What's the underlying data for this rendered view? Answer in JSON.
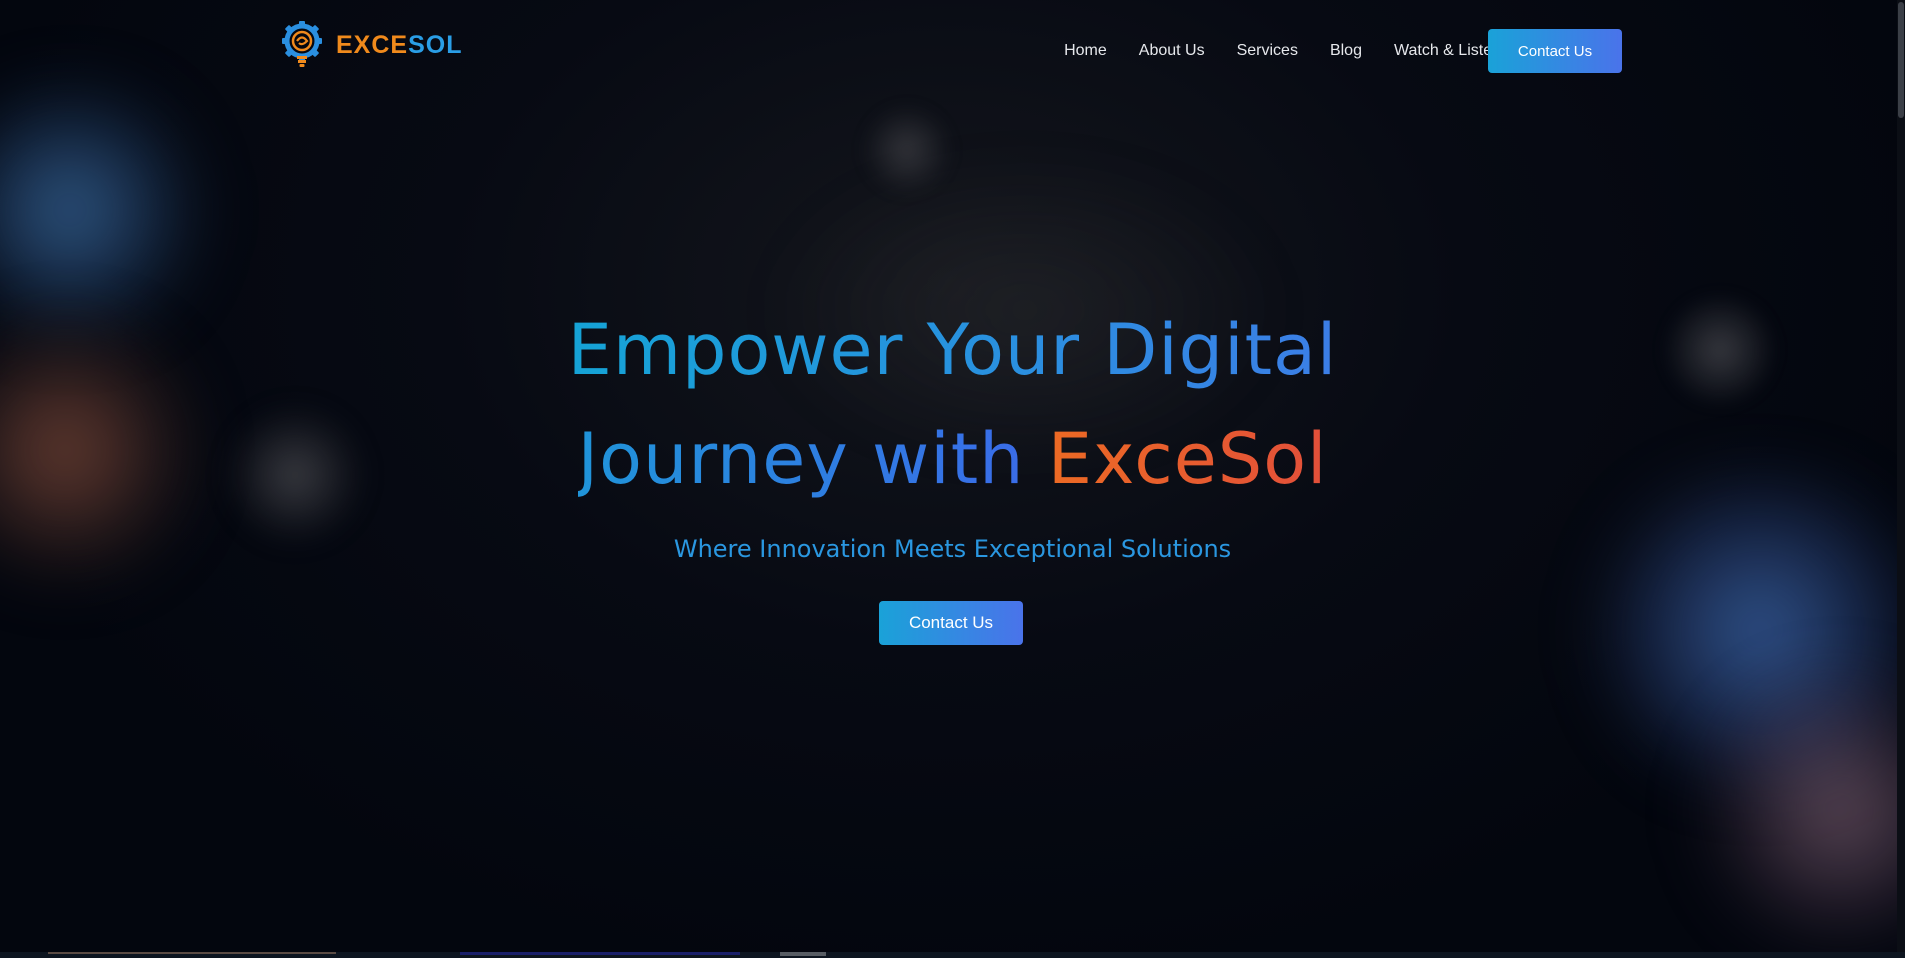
{
  "brand": {
    "logo_part1": "EXCE",
    "logo_part2": "SOL",
    "colors": {
      "orange": "#f08a1c",
      "blue": "#2a9ee6"
    }
  },
  "nav": {
    "items": [
      {
        "label": "Home"
      },
      {
        "label": "About Us"
      },
      {
        "label": "Services"
      },
      {
        "label": "Blog"
      },
      {
        "label": "Watch & Listen"
      }
    ],
    "cta_label": "Contact Us"
  },
  "hero": {
    "line1": "Empower Your Digital",
    "line2_part1": "Journey with",
    "line2_part2": "ExceSol",
    "subtitle": "Where Innovation Meets Exceptional Solutions",
    "cta_label": "Contact Us"
  },
  "theme": {
    "background": "#04070f",
    "accent_gradient_start": "#1aa2d8",
    "accent_gradient_end": "#4a73ea",
    "highlight_orange": "#e24f3a"
  }
}
